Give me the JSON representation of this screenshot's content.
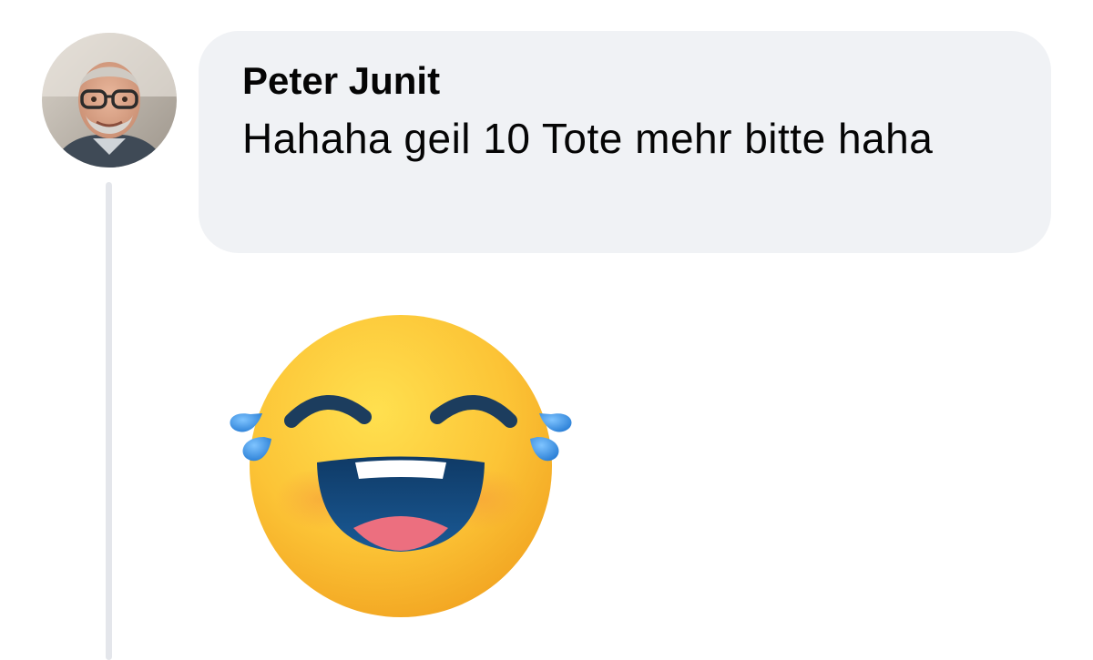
{
  "comment": {
    "author": "Peter Junit",
    "text": "Hahaha geil 10 Tote mehr bitte haha",
    "avatar_icon": "user-avatar-photo",
    "sticker_icon": "face-with-tears-of-joy-icon"
  },
  "colors": {
    "bubble_background": "#f0f2f5",
    "thread_line": "#e4e6eb",
    "text": "#050505",
    "emoji_face": "#fbc02d",
    "tear": "#3d9bea"
  }
}
